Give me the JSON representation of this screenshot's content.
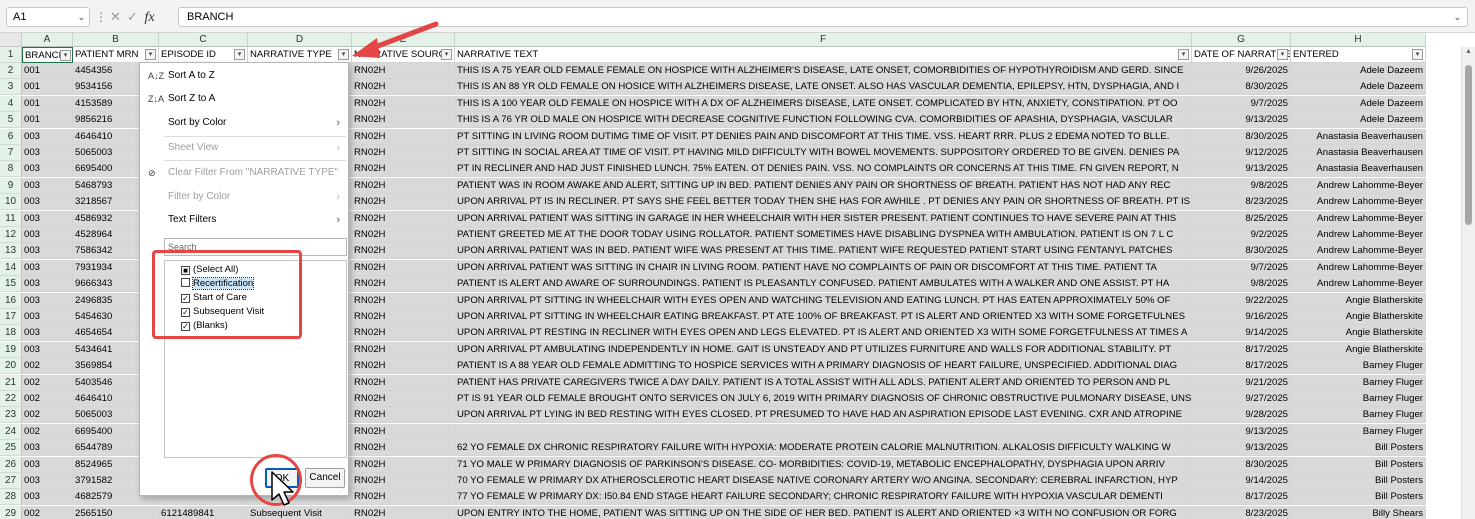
{
  "formula_bar": {
    "name_box": "A1",
    "cancel_glyph": "✕",
    "enter_glyph": "✓",
    "fx_label": "fx",
    "value": "BRANCH"
  },
  "columns": [
    "A",
    "B",
    "C",
    "D",
    "E",
    "F",
    "G",
    "H"
  ],
  "header_row": {
    "row_number": "1",
    "cells": [
      "BRANCH",
      "PATIENT MRN",
      "EPISODE ID",
      "NARRATIVE TYPE",
      "NARRATIVE SOURCE",
      "NARRATIVE TEXT",
      "DATE OF NARRATIVE",
      "ENTERED"
    ]
  },
  "rows": [
    {
      "n": "2",
      "a": "001",
      "b": "4454356",
      "e": "RN02H",
      "f": "THIS IS A 75 YEAR OLD FEMALE FEMALE ON HOSPICE WITH ALZHEIMER'S DISEASE, LATE ONSET, COMORBIDITIES OF HYPOTHYROIDISM AND GERD.  SINCE",
      "g": "9/26/2025",
      "h": "Adele Dazeem"
    },
    {
      "n": "3",
      "a": "001",
      "b": "9534156",
      "e": "RN02H",
      "f": "THIS IS AN 88 YR OLD FEMALE  ON HOSICE WITH ALZHEIMERS DISEASE,  LATE ONSET. ALSO HAS VASCULAR DEMENTIA, EPILEPSY, HTN, DYSPHAGIA, AND I",
      "g": "8/30/2025",
      "h": "Adele Dazeem"
    },
    {
      "n": "4",
      "a": "001",
      "b": "4153589",
      "e": "RN02H",
      "f": "THIS IS A 100 YEAR OLD FEMALE ON HOSPICE WITH A DX OF ALZHEIMERS DISEASE, LATE ONSET. COMPLICATED BY HTN, ANXIETY, CONSTIPATION. PT OO",
      "g": "9/7/2025",
      "h": "Adele Dazeem"
    },
    {
      "n": "5",
      "a": "001",
      "b": "9856216",
      "e": "RN02H",
      "f": "THIS IS A 76 YR OLD MALE ON HOSPICE WITH  DECREASE COGNITIVE FUNCTION FOLLOWING CVA. COMORBIDITIES OF APASHIA, DYSPHAGIA, VASCULAR",
      "g": "9/13/2025",
      "h": "Adele Dazeem"
    },
    {
      "n": "6",
      "a": "003",
      "b": "4646410",
      "e": "RN02H",
      "f": "PT SITTING IN LIVING ROOM DUTIMG TIME OF VISIT. PT DENIES PAIN AND DISCOMFORT AT THIS TIME. VSS. HEART RRR. PLUS 2 EDEMA NOTED TO BLLE.",
      "g": "8/30/2025",
      "h": "Anastasia Beaverhausen"
    },
    {
      "n": "7",
      "a": "003",
      "b": "5065003",
      "e": "RN02H",
      "f": "PT SITTING IN SOCIAL AREA AT TIME OF VISIT. PT HAVING MILD DIFFICULTY WITH BOWEL MOVEMENTS. SUPPOSITORY ORDERED TO BE GIVEN. DENIES PA",
      "g": "9/12/2025",
      "h": "Anastasia Beaverhausen"
    },
    {
      "n": "8",
      "a": "003",
      "b": "6695400",
      "e": "RN02H",
      "f": "PT IN RECLINER AND HAD JUST FINISHED LUNCH. 75% EATEN. OT DENIES PAIN. VSS. NO COMPLAINTS OR CONCERNS AT THIS TIME. FN  GIVEN REPORT, N",
      "g": "9/13/2025",
      "h": "Anastasia Beaverhausen"
    },
    {
      "n": "9",
      "a": "003",
      "b": "5468793",
      "e": "RN02H",
      "f": "PATIENT WAS IN ROOM AWAKE AND ALERT, SITTING UP IN BED. PATIENT DENIES ANY PAIN OR SHORTNESS OF BREATH. PATIENT HAS NOT HAD ANY REC",
      "g": "9/8/2025",
      "h": "Andrew Lahomme-Beyer"
    },
    {
      "n": "10",
      "a": "003",
      "b": "3218567",
      "e": "RN02H",
      "f": "UPON ARRIVAL PT IS IN RECLINER.  PT SAYS SHE FEEL BETTER TODAY THEN SHE HAS FOR AWHILE . PT DENIES ANY PAIN OR SHORTNESS OF BREATH.  PT IS",
      "g": "8/23/2025",
      "h": "Andrew Lahomme-Beyer"
    },
    {
      "n": "11",
      "a": "003",
      "b": "4586932",
      "e": "RN02H",
      "f": "UPON ARRIVAL PATIENT WAS SITTING IN GARAGE IN HER WHEELCHAIR WITH HER SISTER PRESENT. PATIENT CONTINUES TO HAVE SEVERE PAIN AT THIS",
      "g": "8/25/2025",
      "h": "Andrew Lahomme-Beyer"
    },
    {
      "n": "12",
      "a": "003",
      "b": "4528964",
      "e": "RN02H",
      "f": "PATIENT GREETED ME AT THE DOOR TODAY USING ROLLATOR. PATIENT SOMETIMES HAVE DISABLING DYSPNEA WITH AMBULATION. PATIENT IS ON 7 L C",
      "g": "9/2/2025",
      "h": "Andrew Lahomme-Beyer"
    },
    {
      "n": "13",
      "a": "003",
      "b": "7586342",
      "e": "RN02H",
      "f": "UPON ARRIVAL PATIENT WAS IN BED. PATIENT WIFE WAS PRESENT AT THIS TIME. PATIENT WIFE REQUESTED PATIENT START USING FENTANYL PATCHES",
      "g": "8/30/2025",
      "h": "Andrew Lahomme-Beyer"
    },
    {
      "n": "14",
      "a": "003",
      "b": "7931934",
      "e": "RN02H",
      "f": "UPON ARRIVAL PATIENT WAS SITTING IN CHAIR IN LIVING ROOM. PATIENT HAVE NO COMPLAINTS OF PAIN OR DISCOMFORT AT THIS TIME. PATIENT TA",
      "g": "9/7/2025",
      "h": "Andrew Lahomme-Beyer"
    },
    {
      "n": "15",
      "a": "003",
      "b": "9666343",
      "e": "RN02H",
      "f": "PATIENT IS ALERT AND AWARE OF SURROUNDINGS. PATIENT IS PLEASANTLY CONFUSED.  PATIENT AMBULATES WITH A WALKER AND ONE ASSIST. PT HA",
      "g": "9/8/2025",
      "h": "Andrew Lahomme-Beyer"
    },
    {
      "n": "16",
      "a": "003",
      "b": "2496835",
      "e": "RN02H",
      "f": "UPON ARRIVAL PT SITTING IN WHEELCHAIR WITH EYES OPEN AND WATCHING TELEVISION AND EATING LUNCH. PT HAS EATEN APPROXIMATELY 50% OF",
      "g": "9/22/2025",
      "h": "Angie Blatherskite"
    },
    {
      "n": "17",
      "a": "003",
      "b": "5454630",
      "e": "RN02H",
      "f": "UPON ARRIVAL PT SITTING IN WHEELCHAIR EATING BREAKFAST. PT ATE 100% OF BREAKFAST. PT IS ALERT AND ORIENTED X3 WITH SOME FORGETFULNES",
      "g": "9/16/2025",
      "h": "Angie Blatherskite"
    },
    {
      "n": "18",
      "a": "003",
      "b": "4654654",
      "e": "RN02H",
      "f": "UPON ARRIVAL PT RESTING IN RECLINER WITH EYES OPEN AND LEGS ELEVATED. PT IS ALERT AND ORIENTED X3 WITH SOME FORGETFULNESS AT TIMES A",
      "g": "9/14/2025",
      "h": "Angie Blatherskite"
    },
    {
      "n": "19",
      "a": "003",
      "b": "5434641",
      "e": "RN02H",
      "f": "UPON ARRIVAL PT AMBULATING INDEPENDENTLY IN HOME. GAIT IS UNSTEADY AND PT UTILIZES FURNITURE AND WALLS FOR ADDITIONAL STABILITY. PT",
      "g": "8/17/2025",
      "h": "Angie Blatherskite"
    },
    {
      "n": "20",
      "a": "002",
      "b": "3569854",
      "e": "RN02H",
      "f": " PATIENT IS A 88 YEAR OLD FEMALE ADMITTING TO HOSPICE SERVICES WITH A PRIMARY DIAGNOSIS OF HEART FAILURE, UNSPECIFIED. ADDITIONAL DIAG",
      "g": "8/17/2025",
      "h": "Barney Fluger"
    },
    {
      "n": "21",
      "a": "002",
      "b": "5403546",
      "e": "RN02H",
      "f": "PATIENT HAS PRIVATE CAREGIVERS TWICE A DAY DAILY. PATIENT IS A TOTAL ASSIST WITH ALL ADLS. PATIENT ALERT AND ORIENTED TO PERSON AND PL",
      "g": "9/21/2025",
      "h": "Barney Fluger"
    },
    {
      "n": "22",
      "a": "002",
      "b": "4646410",
      "e": "RN02H",
      "f": "PT IS 91 YEAR OLD FEMALE BROUGHT ONTO SERVICES ON JULY 6, 2019 WITH PRIMARY DIAGNOSIS OF CHRONIC OBSTRUCTIVE PULMONARY DISEASE, UNS",
      "g": "9/27/2025",
      "h": "Barney Fluger"
    },
    {
      "n": "23",
      "a": "002",
      "b": "5065003",
      "e": "RN02H",
      "f": "UPON ARRIVAL PT LYING IN BED RESTING WITH EYES CLOSED. PT PRESUMED TO HAVE HAD AN ASPIRATION EPISODE LAST EVENING. CXR AND ATROPINE",
      "g": "9/28/2025",
      "h": "Barney Fluger"
    },
    {
      "n": "24",
      "a": "002",
      "b": "6695400",
      "e": "RN02H",
      "f": "",
      "g": "9/13/2025",
      "h": "Barney Fluger"
    },
    {
      "n": "25",
      "a": "003",
      "b": "6544789",
      "e": "RN02H",
      "f": "62 YO FEMALE DX CHRONIC RESPIRATORY FAILURE WITH HYPOXIA:  MODERATE PROTEIN CALORIE MALNUTRITION.  ALKALOSIS  DIFFICULTY WALKING  W",
      "g": "9/13/2025",
      "h": "Bill Posters"
    },
    {
      "n": "26",
      "a": "003",
      "b": "8524965",
      "e": "RN02H",
      "f": "71 YO MALE W PRIMARY DIAGNOSIS OF PARKINSON'S DISEASE.  CO- MORBIDITIES: COVID-19, METABOLIC ENCEPHALOPATHY, DYSPHAGIA  UPON ARRIV",
      "g": "8/30/2025",
      "h": "Bill Posters"
    },
    {
      "n": "27",
      "a": "003",
      "b": "3791582",
      "e": "RN02H",
      "f": "70 YO FEMALE W PRIMARY DX ATHEROSCLEROTIC HEART DISEASE NATIVE CORONARY ARTERY W/O ANGINA.  SECONDARY: CEREBRAL INFARCTION, HYP",
      "g": "9/14/2025",
      "h": "Bill Posters"
    },
    {
      "n": "28",
      "a": "003",
      "b": "4682579",
      "e": "RN02H",
      "f": "77 YO FEMALE W PRIMARY DX:   I50.84 END STAGE HEART FAILURE   SECONDARY;  CHRONIC RESPIRATORY FAILURE WITH HYPOXIA    VASCULAR DEMENTI",
      "g": "8/17/2025",
      "h": "Bill Posters"
    },
    {
      "n": "29",
      "a": "002",
      "b": "2565150",
      "c": "6121489841",
      "d": "Subsequent Visit",
      "e": "RN02H",
      "f": "UPON ENTRY INTO THE HOME, PATIENT WAS SITTING UP ON THE SIDE OF HER BED. PATIENT IS ALERT AND ORIENTED ×3 WITH NO CONFUSION OR FORG",
      "g": "8/23/2025",
      "h": "Billy Shears"
    }
  ],
  "filter_menu": {
    "sort_a_to_z": "Sort A to Z",
    "sort_z_to_a": "Sort Z to A",
    "sort_by_color": "Sort by Color",
    "sheet_view": "Sheet View",
    "clear_filter": "Clear Filter From \"NARRATIVE TYPE\"",
    "filter_by_color": "Filter by Color",
    "text_filters": "Text Filters",
    "search_placeholder": "Search",
    "items": [
      {
        "label": "(Select All)",
        "check": "■"
      },
      {
        "label": "Recertification",
        "check": ""
      },
      {
        "label": "Start of Care",
        "check": "✓"
      },
      {
        "label": "Subsequent Visit",
        "check": "✓"
      },
      {
        "label": "(Blanks)",
        "check": "✓"
      }
    ],
    "ok_label": "OK",
    "cancel_label": "Cancel"
  },
  "colors": {
    "annotation_red": "#e64545",
    "header_green": "#e3f1e7",
    "filtered_gray": "#d9d9d9"
  }
}
